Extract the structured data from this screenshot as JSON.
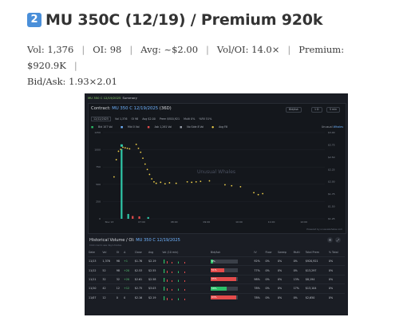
{
  "heading": {
    "badge": "2",
    "text": "MU 350C (12/19) / Premium 920k"
  },
  "stats": [
    {
      "label": "Vol:",
      "value": "1,376"
    },
    {
      "label": "OI:",
      "value": "98"
    },
    {
      "label": "Avg:",
      "value": "~$2.00"
    },
    {
      "label": "Vol/OI:",
      "value": "14.0×"
    },
    {
      "label": "Premium:",
      "value": "$920.9K"
    },
    {
      "label": "Bid/Ask:",
      "value": "1.93×2.01"
    }
  ],
  "screenshot": {
    "breadcrumb": "MU 350 C 12/19/2025",
    "breadcrumb_tab": "Summary",
    "contract": {
      "prefix": "Contract:",
      "name": "MU 350 C 12/19/2025",
      "dte": "(36D)"
    },
    "controls": [
      "Bid/Ask",
      "1 D",
      "5 min"
    ],
    "stat_items": [
      "12/12/2025",
      "Vol 1,376",
      "OI 98",
      "Avg $2.00",
      "Prem $920,921",
      "Multi 0%",
      "%Fill 51%"
    ],
    "legend_items": [
      "Bid 107 Vol",
      "Mid 0 Vol",
      "Ask 1,261 Vol",
      "No Side 8 Vol",
      "Avg Fill"
    ],
    "chart_link": {
      "prefix": "Unusual",
      "name": "Whales"
    },
    "watermark": "Unusual Whales",
    "powered_by": "Powered by unusualwhales.com",
    "history": {
      "title_prefix": "Historical Volume / OI:",
      "title_contract": "MU 350 C 12/19/2025",
      "subtitle": "Click row to see day's trades",
      "columns": [
        "Date",
        "Vol",
        "OI",
        "Δ",
        "Close",
        "Avg",
        "Vol (10 min)",
        "",
        "Bid/Ask",
        "IV",
        "Floor",
        "Sweep",
        "Multi",
        "Total Prem",
        "% Total"
      ],
      "rows": [
        {
          "date": "11/13",
          "vol": "1,376",
          "oi": "98",
          "delta": "+1",
          "close": "$1.76",
          "avg": "$2.19",
          "bidask": "8%",
          "bidask_pct": 0.08,
          "bidask_color": "#2bbf68",
          "iv": "92%",
          "floor": "0%",
          "sweep": "0%",
          "multi": "0%",
          "total_prem": "$920,921",
          "pct_total": "0%",
          "dir": "pos"
        },
        {
          "date": "11/12",
          "vol": "52",
          "oi": "98",
          "delta": "+20",
          "close": "$2.53",
          "avg": "$2.55",
          "bidask": "51%",
          "bidask_pct": 0.51,
          "bidask_color": "#e34b4b",
          "iv": "77%",
          "floor": "0%",
          "sweep": "0%",
          "multi": "0%",
          "total_prem": "$13,297",
          "pct_total": "0%",
          "dir": "pos"
        },
        {
          "date": "11/11",
          "vol": "32",
          "oi": "32",
          "delta": "+20",
          "close": "$2.61",
          "avg": "$2.58",
          "bidask": "95%",
          "bidask_pct": 0.95,
          "bidask_color": "#e34b4b",
          "iv": "98%",
          "floor": "0%",
          "sweep": "0%",
          "multi": "13%",
          "total_prem": "$8,194",
          "pct_total": "0%",
          "dir": "pos"
        },
        {
          "date": "11/10",
          "vol": "42",
          "oi": "12",
          "delta": "+12",
          "close": "$2.75",
          "avg": "$3.03",
          "bidask": "58%",
          "bidask_pct": 0.58,
          "bidask_color": "#2bbf68",
          "iv": "78%",
          "floor": "0%",
          "sweep": "0%",
          "multi": "17%",
          "total_prem": "$13,104",
          "pct_total": "0%",
          "dir": "pos"
        },
        {
          "date": "11/07",
          "vol": "12",
          "oi": "0",
          "delta": "0",
          "close": "$2.16",
          "avg": "$2.19",
          "bidask": "93%",
          "bidask_pct": 0.93,
          "bidask_color": "#e34b4b",
          "iv": "78%",
          "floor": "0%",
          "sweep": "0%",
          "multi": "0%",
          "total_prem": "$2,650",
          "pct_total": "0%",
          "dir": "neutral"
        }
      ]
    }
  },
  "chart_data": {
    "type": "bar",
    "title": "",
    "x_ticks": [
      "Nov 13",
      "07:00",
      "08:00",
      "09:00",
      "10:00",
      "11:00",
      "12:00"
    ],
    "y_left_ticks": [
      0,
      250,
      500,
      750,
      1000,
      1250
    ],
    "y_right_ticks": [
      "$1.25",
      "$1.50",
      "$1.75",
      "$2.00",
      "$2.25",
      "$2.50",
      "$2.75",
      "$3.00"
    ],
    "ylim_left": [
      0,
      1250
    ],
    "ylim_right": [
      1.25,
      3.0
    ],
    "volume_bars": [
      {
        "t": 0.08,
        "v": 1010,
        "side": "ask"
      },
      {
        "t": 0.11,
        "v": 70,
        "side": "ask"
      },
      {
        "t": 0.13,
        "v": 40,
        "side": "bid"
      },
      {
        "t": 0.16,
        "v": 35,
        "side": "bid"
      },
      {
        "t": 0.2,
        "v": 25,
        "side": "ask"
      }
    ],
    "avg_fill": [
      {
        "t": 0.05,
        "p": 2.1
      },
      {
        "t": 0.06,
        "p": 2.45
      },
      {
        "t": 0.07,
        "p": 2.62
      },
      {
        "t": 0.08,
        "p": 2.66
      },
      {
        "t": 0.09,
        "p": 2.7
      },
      {
        "t": 0.1,
        "p": 2.69
      },
      {
        "t": 0.11,
        "p": 2.68
      },
      {
        "t": 0.12,
        "p": 2.67
      },
      {
        "t": 0.15,
        "p": 2.76
      },
      {
        "t": 0.16,
        "p": 2.68
      },
      {
        "t": 0.17,
        "p": 2.6
      },
      {
        "t": 0.18,
        "p": 2.48
      },
      {
        "t": 0.19,
        "p": 2.36
      },
      {
        "t": 0.2,
        "p": 2.25
      },
      {
        "t": 0.21,
        "p": 2.15
      },
      {
        "t": 0.22,
        "p": 2.06
      },
      {
        "t": 0.23,
        "p": 2.0
      },
      {
        "t": 0.24,
        "p": 1.97
      },
      {
        "t": 0.26,
        "p": 1.99
      },
      {
        "t": 0.28,
        "p": 1.96
      },
      {
        "t": 0.3,
        "p": 1.98
      },
      {
        "t": 0.33,
        "p": 1.97
      },
      {
        "t": 0.38,
        "p": 2.0
      },
      {
        "t": 0.4,
        "p": 1.99
      },
      {
        "t": 0.42,
        "p": 2.0
      },
      {
        "t": 0.44,
        "p": 2.01
      },
      {
        "t": 0.48,
        "p": 2.02
      },
      {
        "t": 0.55,
        "p": 1.94
      },
      {
        "t": 0.58,
        "p": 1.92
      },
      {
        "t": 0.62,
        "p": 1.9
      },
      {
        "t": 0.68,
        "p": 1.78
      },
      {
        "t": 0.7,
        "p": 1.74
      },
      {
        "t": 0.72,
        "p": 1.76
      }
    ],
    "grid": true,
    "legend_position": "top-left"
  }
}
